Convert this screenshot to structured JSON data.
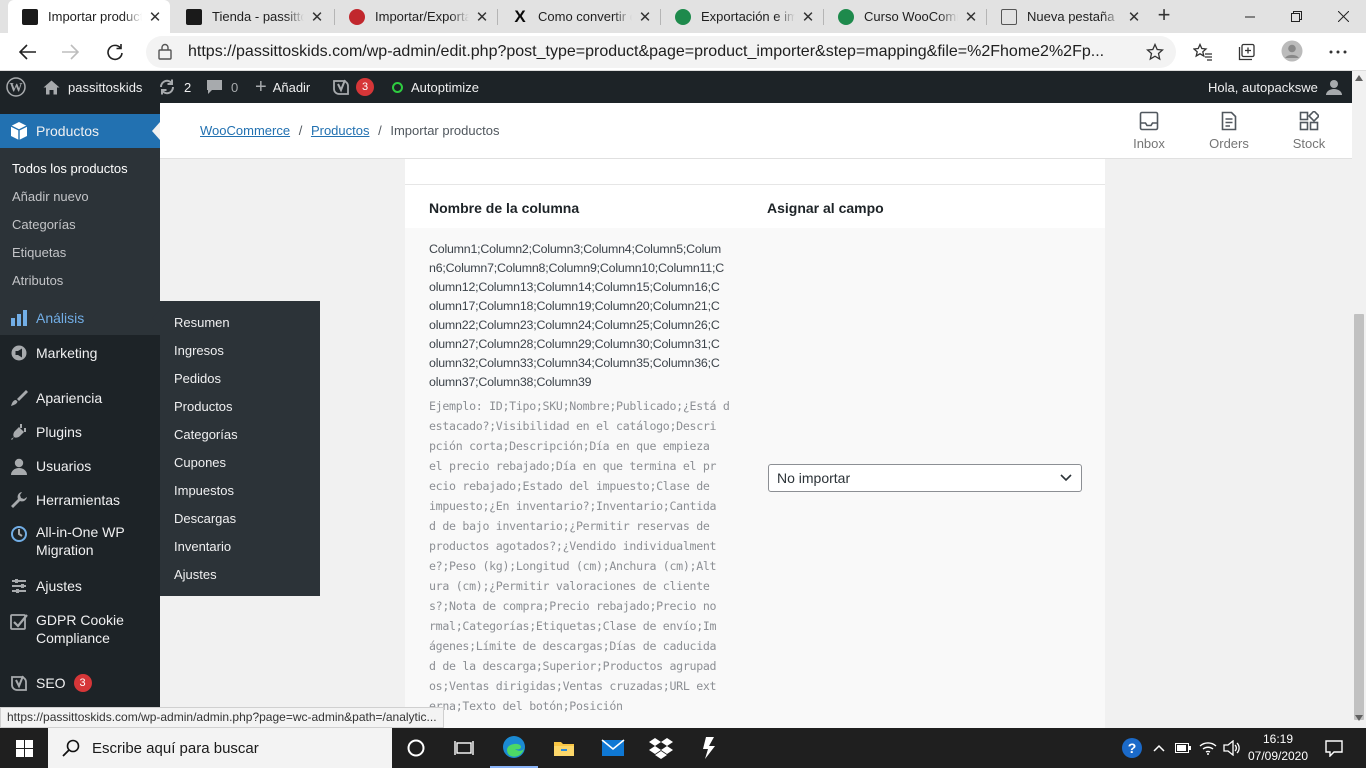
{
  "browser": {
    "tabs": [
      {
        "title": "Importar productos",
        "favicon_color": "#1a1a1a",
        "active": true
      },
      {
        "title": "Tienda - passittoskids",
        "favicon_color": "#1a1a1a",
        "active": false
      },
      {
        "title": "Importar/Exportar",
        "favicon_color": "#c1272d",
        "active": false
      },
      {
        "title": "Como convertir de",
        "favicon_color": "#0a0a0a",
        "active": false
      },
      {
        "title": "Exportación e imp",
        "favicon_color": "#1e8a4c",
        "active": false
      },
      {
        "title": "Curso WooComme",
        "favicon_color": "#1e8a4c",
        "active": false
      },
      {
        "title": "Nueva pestaña",
        "favicon_color": "#555555",
        "active": false
      }
    ],
    "url": "https://passittoskids.com/wp-admin/edit.php?post_type=product&page=product_importer&step=mapping&file=%2Fhome2%2Fp..."
  },
  "adminbar": {
    "site_name": "passittoskids",
    "updates_count": "2",
    "comments_count": "0",
    "add_label": "Añadir",
    "yoast_badge": "3",
    "autoptimize_label": "Autoptimize",
    "greeting": "Hola, autopackswe"
  },
  "sidebar": {
    "active_menu": "Productos",
    "submenu": [
      "Todos los productos",
      "Añadir nuevo",
      "Categorías",
      "Etiquetas",
      "Atributos"
    ],
    "menu": [
      {
        "label": "Análisis",
        "icon": "bar-chart-icon"
      },
      {
        "label": "Marketing",
        "icon": "megaphone-icon"
      },
      {
        "label": "Apariencia",
        "icon": "brush-icon"
      },
      {
        "label": "Plugins",
        "icon": "plug-icon"
      },
      {
        "label": "Usuarios",
        "icon": "user-icon"
      },
      {
        "label": "Herramientas",
        "icon": "wrench-icon"
      },
      {
        "label": "All-in-One WP",
        "label2": "Migration",
        "icon": "migration-icon"
      },
      {
        "label": "Ajustes",
        "icon": "settings-icon"
      },
      {
        "label": "GDPR Cookie",
        "label2": "Compliance",
        "icon": "check-icon"
      },
      {
        "label": "SEO",
        "icon": "yoast-icon",
        "badge": "3"
      }
    ],
    "flyout": [
      "Resumen",
      "Ingresos",
      "Pedidos",
      "Productos",
      "Categorías",
      "Cupones",
      "Impuestos",
      "Descargas",
      "Inventario",
      "Ajustes"
    ]
  },
  "wc_header": {
    "breadcrumb": [
      "WooCommerce",
      "Productos",
      "Importar productos"
    ],
    "buttons": [
      "Inbox",
      "Orders",
      "Stock"
    ]
  },
  "mapping": {
    "col_header_name": "Nombre de la columna",
    "col_header_field": "Asignar al campo",
    "column_lines": [
      "Column1;Column2;Column3;Column4;Column5;Colum",
      "n6;Column7;Column8;Column9;Column10;Column11;C",
      "olumn12;Column13;Column14;Column15;Column16;C",
      "olumn17;Column18;Column19;Column20;Column21;C",
      "olumn22;Column23;Column24;Column25;Column26;C",
      "olumn27;Column28;Column29;Column30;Column31;C",
      "olumn32;Column33;Column34;Column35;Column36;C",
      "olumn37;Column38;Column39"
    ],
    "example_lines": [
      "Ejemplo: ID;Tipo;SKU;Nombre;Publicado;¿Está d",
      "estacado?;Visibilidad en el catálogo;Descri",
      "pción corta;Descripción;Día en que empieza",
      "el precio rebajado;Día en que termina el pr",
      "ecio rebajado;Estado del impuesto;Clase de",
      "impuesto;¿En inventario?;Inventario;Cantida",
      "d de bajo inventario;¿Permitir reservas de",
      "productos agotados?;¿Vendido individualment",
      "e?;Peso (kg);Longitud (cm);Anchura (cm);Alt",
      "ura (cm);¿Permitir valoraciones de cliente",
      "s?;Nota de compra;Precio rebajado;Precio no",
      "rmal;Categorías;Etiquetas;Clase de envío;Im",
      "ágenes;Límite de descargas;Días de caducida",
      "d de la descarga;Superior;Productos agrupad",
      "os;Ventas dirigidas;Ventas cruzadas;URL ext",
      "erna;Texto del botón;Posición"
    ],
    "select_value": "No importar"
  },
  "status_url": "https://passittoskids.com/wp-admin/admin.php?page=wc-admin&path=/analytic...",
  "taskbar": {
    "search_placeholder": "Escribe aquí para buscar",
    "time": "16:19",
    "date": "07/09/2020"
  },
  "colors": {
    "wp_blue": "#2271b1",
    "admin_dark": "#1d2327",
    "flyout": "#2c3338"
  }
}
